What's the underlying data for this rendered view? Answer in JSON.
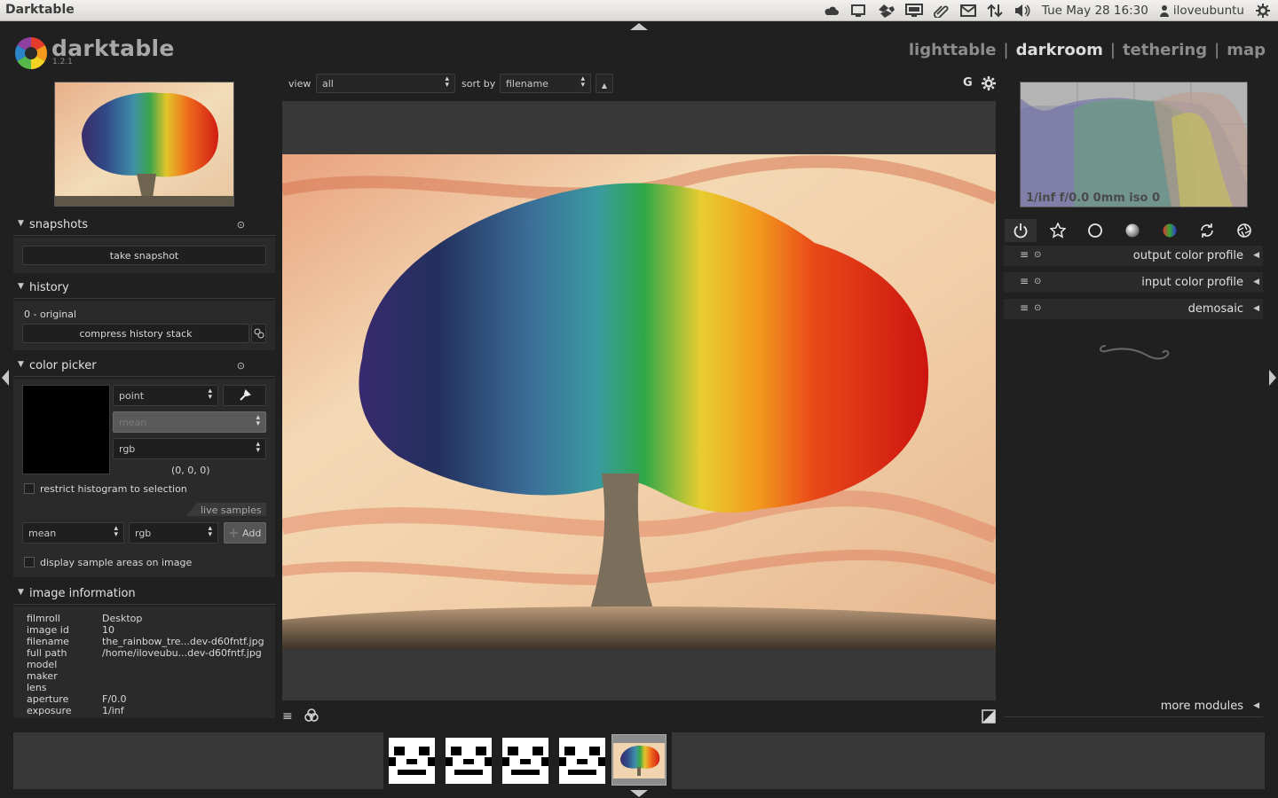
{
  "window": {
    "app_name": "Darktable"
  },
  "system_tray": {
    "clock": "Tue May 28 16:30",
    "user": "iloveubuntu",
    "icons": [
      "cloud-icon",
      "display-icon",
      "dropbox-icon",
      "network-icon",
      "attachment-icon",
      "mail-icon",
      "transfer-icon",
      "volume-icon",
      "settings-gear-icon"
    ]
  },
  "header": {
    "logo_text": "darktable",
    "version": "1.2.1",
    "views": [
      "lighttable",
      "darkroom",
      "tethering",
      "map"
    ],
    "separator": "|",
    "active_view": "darkroom"
  },
  "top_filter": {
    "view_label": "view",
    "view_value": "all",
    "sort_label": "sort by",
    "sort_value": "filename",
    "sort_dir_symbol": "▲",
    "grouping_label": "G"
  },
  "left_panel": {
    "snapshots": {
      "title": "snapshots",
      "take_snapshot": "take snapshot"
    },
    "history": {
      "title": "history",
      "items": [
        "0 - original"
      ],
      "compress": "compress history stack"
    },
    "color_picker": {
      "title": "color picker",
      "mode": "point",
      "statistic": "mean",
      "colorspace": "rgb",
      "value": "(0, 0, 0)",
      "swatch_color": "#000000",
      "restrict_label": "restrict histogram to selection",
      "live_samples_label": "live samples",
      "sample_stat": "mean",
      "sample_space": "rgb",
      "add_label": "Add",
      "display_samples_label": "display sample areas on image"
    },
    "image_information": {
      "title": "image information",
      "rows": [
        {
          "key": "filmroll",
          "value": "Desktop"
        },
        {
          "key": "image id",
          "value": "10"
        },
        {
          "key": "filename",
          "value": "the_rainbow_tre...dev-d60fntf.jpg"
        },
        {
          "key": "full path",
          "value": "/home/iloveubu...dev-d60fntf.jpg"
        },
        {
          "key": "model",
          "value": ""
        },
        {
          "key": "maker",
          "value": ""
        },
        {
          "key": "lens",
          "value": ""
        },
        {
          "key": "aperture",
          "value": "F/0.0"
        },
        {
          "key": "exposure",
          "value": "1/inf"
        }
      ]
    }
  },
  "right_panel": {
    "histogram_exif": "1/inf f/0.0 0mm iso 0",
    "module_groups": [
      "power-icon",
      "star-icon",
      "circle-icon",
      "sphere-icon",
      "color-icon",
      "rotate-icon",
      "aperture-icon"
    ],
    "modules": [
      {
        "title": "output color profile"
      },
      {
        "title": "input color profile"
      },
      {
        "title": "demosaic"
      }
    ],
    "more_modules": "more modules"
  },
  "colors": {
    "accent_bg": "#202020",
    "panel_bg": "#2a2a2a",
    "center_bg": "#383838"
  }
}
